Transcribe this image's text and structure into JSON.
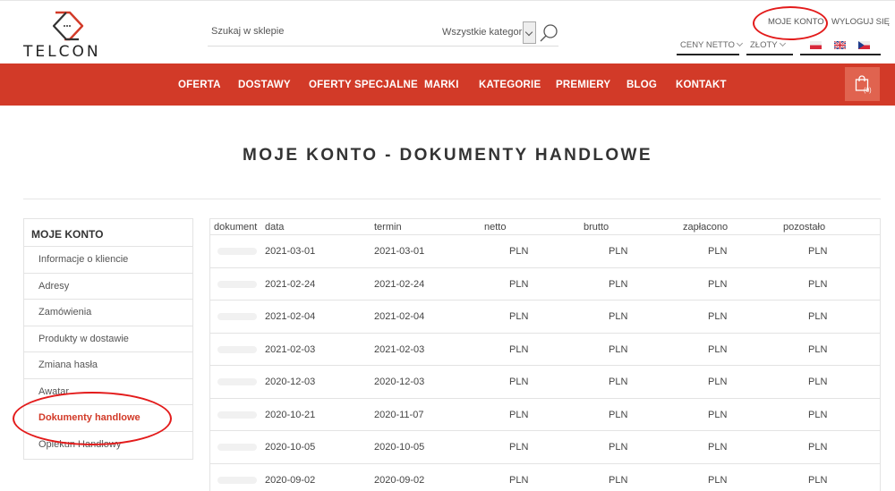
{
  "header": {
    "logo_text": "TELCON",
    "search": {
      "placeholder": "Szukaj w sklepie",
      "category": "Wszystkie kategorie"
    },
    "account_link": "MOJE KONTO",
    "logout_link": "WYLOGUJ SIĘ",
    "prices_selector": "CENY NETTO",
    "currency_selector": "ZŁOTY",
    "languages": [
      "pl",
      "en",
      "cz"
    ]
  },
  "nav": {
    "items": [
      "OFERTA",
      "DOSTAWY",
      "OFERTY SPECJALNE",
      "MARKI",
      "KATEGORIE",
      "PREMIERY",
      "BLOG",
      "KONTAKT"
    ],
    "cart_count": "(0)"
  },
  "page": {
    "title": "MOJE KONTO - DOKUMENTY HANDLOWE"
  },
  "sidebar": {
    "title": "MOJE KONTO",
    "items": [
      {
        "label": "Informacje o kliencie"
      },
      {
        "label": "Adresy"
      },
      {
        "label": "Zamówienia"
      },
      {
        "label": "Produkty w dostawie"
      },
      {
        "label": "Zmiana hasła"
      },
      {
        "label": "Awatar"
      },
      {
        "label": "Dokumenty handlowe",
        "active": true
      },
      {
        "label": "Opiekun Handlowy"
      }
    ]
  },
  "table": {
    "headers": [
      "dokument",
      "data",
      "termin",
      "netto",
      "brutto",
      "zapłacono",
      "pozostało"
    ],
    "currency": "PLN",
    "rows": [
      {
        "data": "2021-03-01",
        "termin": "2021-03-01"
      },
      {
        "data": "2021-02-24",
        "termin": "2021-02-24"
      },
      {
        "data": "2021-02-04",
        "termin": "2021-02-04"
      },
      {
        "data": "2021-02-03",
        "termin": "2021-02-03"
      },
      {
        "data": "2020-12-03",
        "termin": "2020-12-03"
      },
      {
        "data": "2020-10-21",
        "termin": "2020-11-07"
      },
      {
        "data": "2020-10-05",
        "termin": "2020-10-05"
      },
      {
        "data": "2020-09-02",
        "termin": "2020-09-02"
      }
    ]
  },
  "colors": {
    "brand": "#d23a28",
    "annotation": "#e31b1b"
  }
}
